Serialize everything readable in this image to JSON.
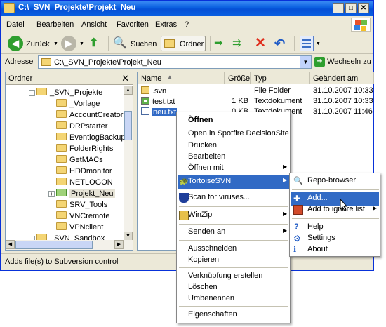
{
  "window": {
    "title": "C:\\_SVN_Projekte\\Projekt_Neu",
    "min": "_",
    "max": "□",
    "close": "✕"
  },
  "menubar": [
    "Datei",
    "Bearbeiten",
    "Ansicht",
    "Favoriten",
    "Extras",
    "?"
  ],
  "toolbar": {
    "back_label": "Zurück",
    "search_label": "Suchen",
    "folders_label": "Ordner"
  },
  "address": {
    "label": "Adresse",
    "value": "C:\\_SVN_Projekte\\Projekt_Neu",
    "go_label": "Wechseln zu"
  },
  "folder_pane": {
    "header": "Ordner",
    "close": "✕",
    "items": [
      {
        "label": "_SVN_Projekte",
        "expanded": true
      },
      {
        "label": "_Vorlage"
      },
      {
        "label": "AccountCreator"
      },
      {
        "label": "DRPstarter"
      },
      {
        "label": "EventlogBackup"
      },
      {
        "label": "FolderRights"
      },
      {
        "label": "GetMACs"
      },
      {
        "label": "HDDmonitor"
      },
      {
        "label": "NETLOGON"
      },
      {
        "label": "Projekt_Neu",
        "expandable": true
      },
      {
        "label": "SRV_Tools"
      },
      {
        "label": "VNCremote"
      },
      {
        "label": "VPNclient"
      },
      {
        "label": "_SVN_Sandbox",
        "expandable": true
      }
    ]
  },
  "file_list": {
    "columns": [
      "Name",
      "Größe",
      "Typ",
      "Geändert am"
    ],
    "rows": [
      {
        "name": ".svn",
        "size": "",
        "type": "File Folder",
        "modified": "31.10.2007 10:33"
      },
      {
        "name": "test.txt",
        "size": "1 KB",
        "type": "Textdokument",
        "modified": "31.10.2007 10:33"
      },
      {
        "name": "neu.txt",
        "size": "0 KB",
        "type": "Textdokument",
        "modified": "31.10.2007 11:46",
        "selected": true
      }
    ]
  },
  "status_text": "Adds file(s) to Subversion control",
  "context_menu": {
    "items": {
      "open": "Öffnen",
      "open_spotfire": "Open in Spotfire DecisionSite",
      "print": "Drucken",
      "edit": "Bearbeiten",
      "open_with": "Öffnen mit",
      "tortoise": "TortoiseSVN",
      "scan": "Scan for viruses...",
      "winzip": "WinZip",
      "send_to": "Senden an",
      "cut": "Ausschneiden",
      "copy": "Kopieren",
      "shortcut": "Verknüpfung erstellen",
      "delete": "Löschen",
      "rename": "Umbenennen",
      "properties": "Eigenschaften"
    }
  },
  "svn_submenu": {
    "repo_browser": "Repo-browser",
    "add": "Add...",
    "ignore": "Add to ignore list",
    "help": "Help",
    "settings": "Settings",
    "about": "About"
  },
  "colors": {
    "titlebar": "#0a5fe0",
    "selection": "#316ac5",
    "folder": "#f4d574"
  }
}
